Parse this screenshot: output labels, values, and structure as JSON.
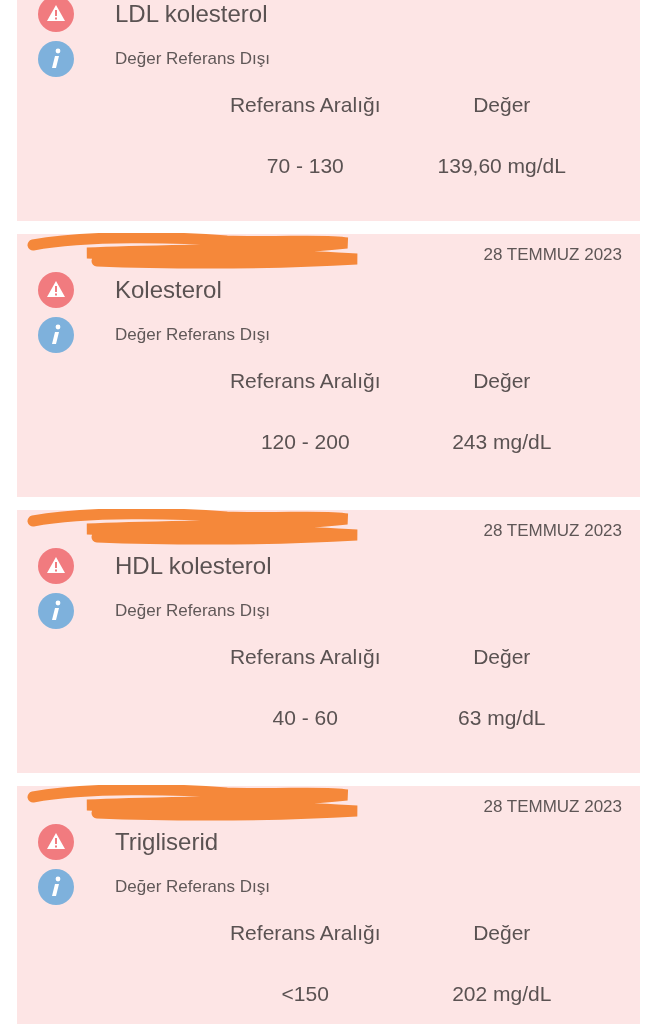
{
  "results": [
    {
      "test": "LDL kolesterol",
      "status": "Değer Referans Dışı",
      "range_label": "Referans Aralığı",
      "value_label": "Değer",
      "range": "70 - 130",
      "value": "139,60 mg/dL"
    },
    {
      "date": "28 TEMMUZ 2023",
      "test": "Kolesterol",
      "status": "Değer Referans Dışı",
      "range_label": "Referans Aralığı",
      "value_label": "Değer",
      "range": "120 - 200",
      "value": "243 mg/dL"
    },
    {
      "date": "28 TEMMUZ 2023",
      "test": "HDL kolesterol",
      "status": "Değer Referans Dışı",
      "range_label": "Referans Aralığı",
      "value_label": "Değer",
      "range": "40 - 60",
      "value": "63 mg/dL"
    },
    {
      "date": "28 TEMMUZ 2023",
      "test": "Trigliserid",
      "status": "Değer Referans Dışı",
      "range_label": "Referans Aralığı",
      "value_label": "Değer",
      "range": "<150",
      "value": "202 mg/dL"
    }
  ]
}
